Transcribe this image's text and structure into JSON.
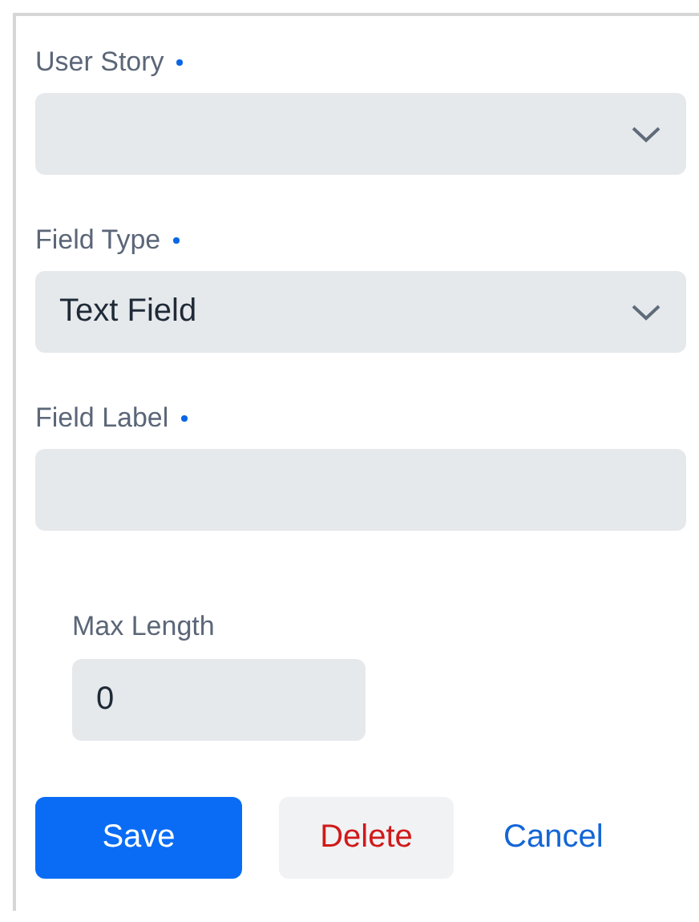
{
  "fields": [
    {
      "kind": "select",
      "label": "User Story",
      "required": true
    },
    {
      "kind": "select",
      "label": "Field Type",
      "required": true,
      "value": "Text Field"
    },
    {
      "kind": "text",
      "label": "Field Label",
      "required": true
    }
  ],
  "max_length": {
    "label": "Max Length",
    "value": "0"
  },
  "buttons": [
    {
      "kind": "primary",
      "label": "Save"
    },
    {
      "kind": "danger",
      "label": "Delete"
    },
    {
      "kind": "link",
      "label": "Cancel"
    }
  ]
}
